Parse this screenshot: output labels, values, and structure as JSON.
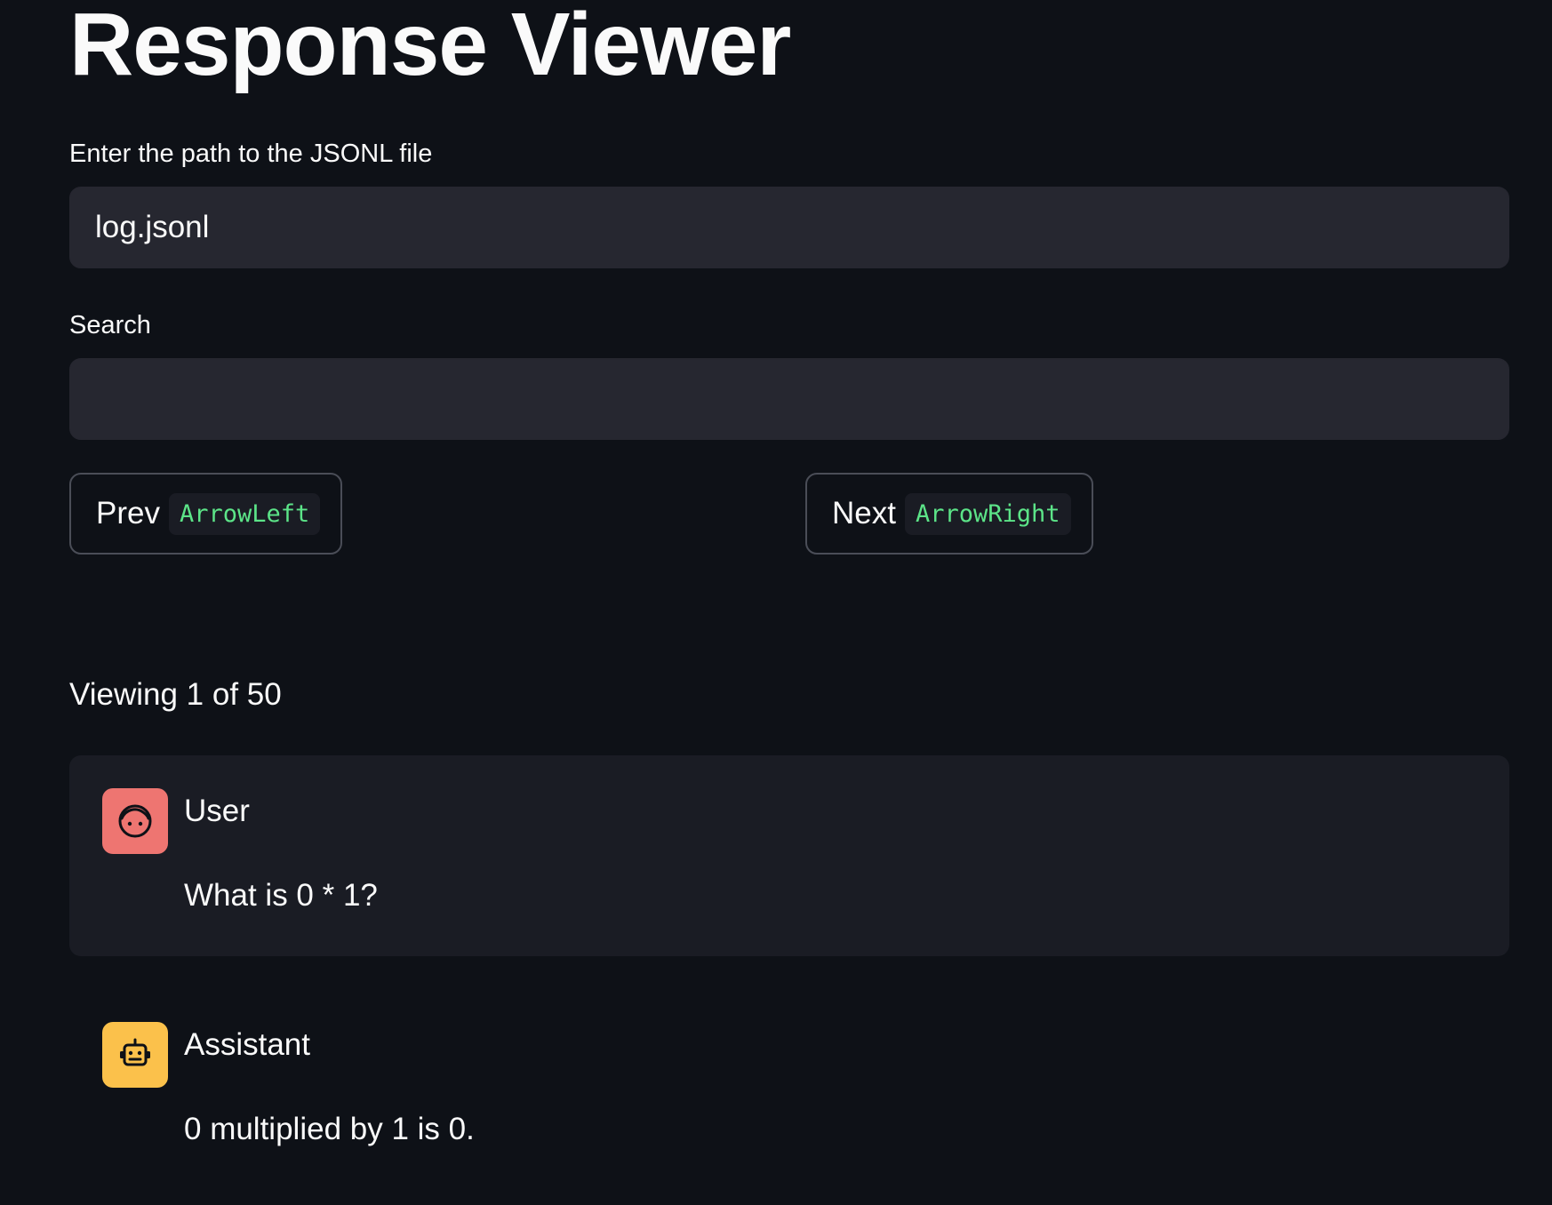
{
  "page": {
    "title": "Response Viewer"
  },
  "path_field": {
    "label": "Enter the path to the JSONL file",
    "value": "log.jsonl"
  },
  "search_field": {
    "label": "Search",
    "value": ""
  },
  "navigation": {
    "prev_label": "Prev",
    "prev_shortcut": "ArrowLeft",
    "next_label": "Next",
    "next_shortcut": "ArrowRight"
  },
  "status": {
    "viewing_text": "Viewing 1 of 50"
  },
  "messages": [
    {
      "role": "User",
      "text": "What is 0 * 1?",
      "avatar_icon": "face-icon",
      "avatar_color": "#ee7571"
    },
    {
      "role": "Assistant",
      "text": "0 multiplied by 1 is 0.",
      "avatar_icon": "robot-icon",
      "avatar_color": "#fbc14b"
    }
  ],
  "colors": {
    "background": "#0e1117",
    "input_background": "#262730",
    "shortcut_text": "#5ce488"
  }
}
